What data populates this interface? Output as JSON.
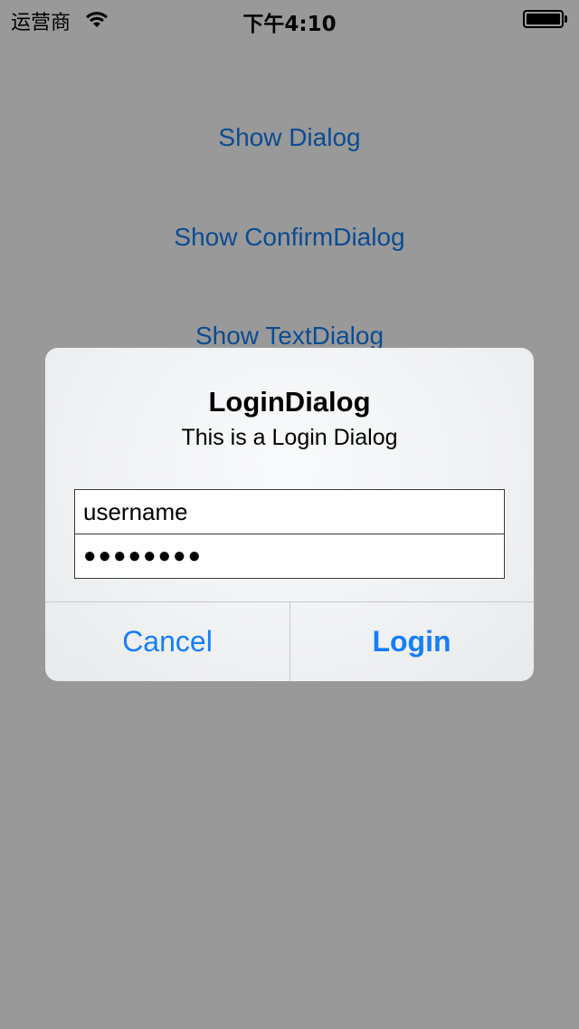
{
  "status_bar": {
    "carrier": "运营商",
    "time": "下午4:10",
    "wifi_icon": "wifi-icon",
    "battery_icon": "battery-icon"
  },
  "main": {
    "buttons": [
      "Show Dialog",
      "Show ConfirmDialog",
      "Show TextDialog"
    ]
  },
  "dialog": {
    "title": "LoginDialog",
    "message": "This is a Login Dialog",
    "username_value": "username",
    "password_value": "●●●●●●●●",
    "cancel_label": "Cancel",
    "login_label": "Login"
  },
  "colors": {
    "background": "#999999",
    "link": "#0b4c92",
    "dialog_button": "#157efb"
  }
}
